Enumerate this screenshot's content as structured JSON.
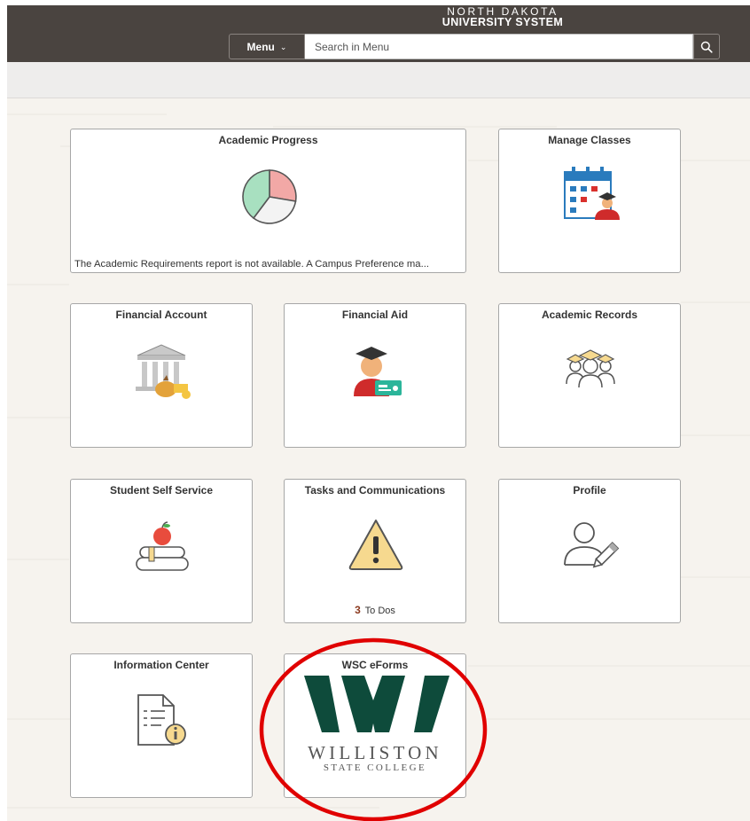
{
  "header": {
    "brand_line1": "NORTH DAKOTA",
    "brand_line2": "UNIVERSITY SYSTEM",
    "menu_label": "Menu",
    "search_placeholder": "Search in Menu"
  },
  "tiles": [
    {
      "title": "Academic Progress",
      "footer": "The Academic Requirements report is not available.  A Campus Preference ma...",
      "icon": "pie-chart-icon"
    },
    {
      "title": "Manage Classes",
      "icon": "calendar-student-icon"
    },
    {
      "title": "Financial Account",
      "icon": "bank-money-icon"
    },
    {
      "title": "Financial Aid",
      "icon": "graduate-check-icon"
    },
    {
      "title": "Academic Records",
      "icon": "graduates-group-icon"
    },
    {
      "title": "Student Self Service",
      "icon": "books-apple-icon"
    },
    {
      "title": "Tasks and Communications",
      "icon": "warning-icon",
      "todo_count": "3",
      "todo_label": "To Dos"
    },
    {
      "title": "Profile",
      "icon": "profile-edit-icon"
    },
    {
      "title": "Information Center",
      "icon": "document-info-icon"
    },
    {
      "title": "WSC eForms",
      "icon": "williston-logo",
      "logo_line1": "WILLISTON",
      "logo_line2": "STATE COLLEGE"
    }
  ],
  "colors": {
    "header_bg": "#4a4440",
    "logo_green": "#0e4b3b",
    "annotation_red": "#e00000"
  }
}
